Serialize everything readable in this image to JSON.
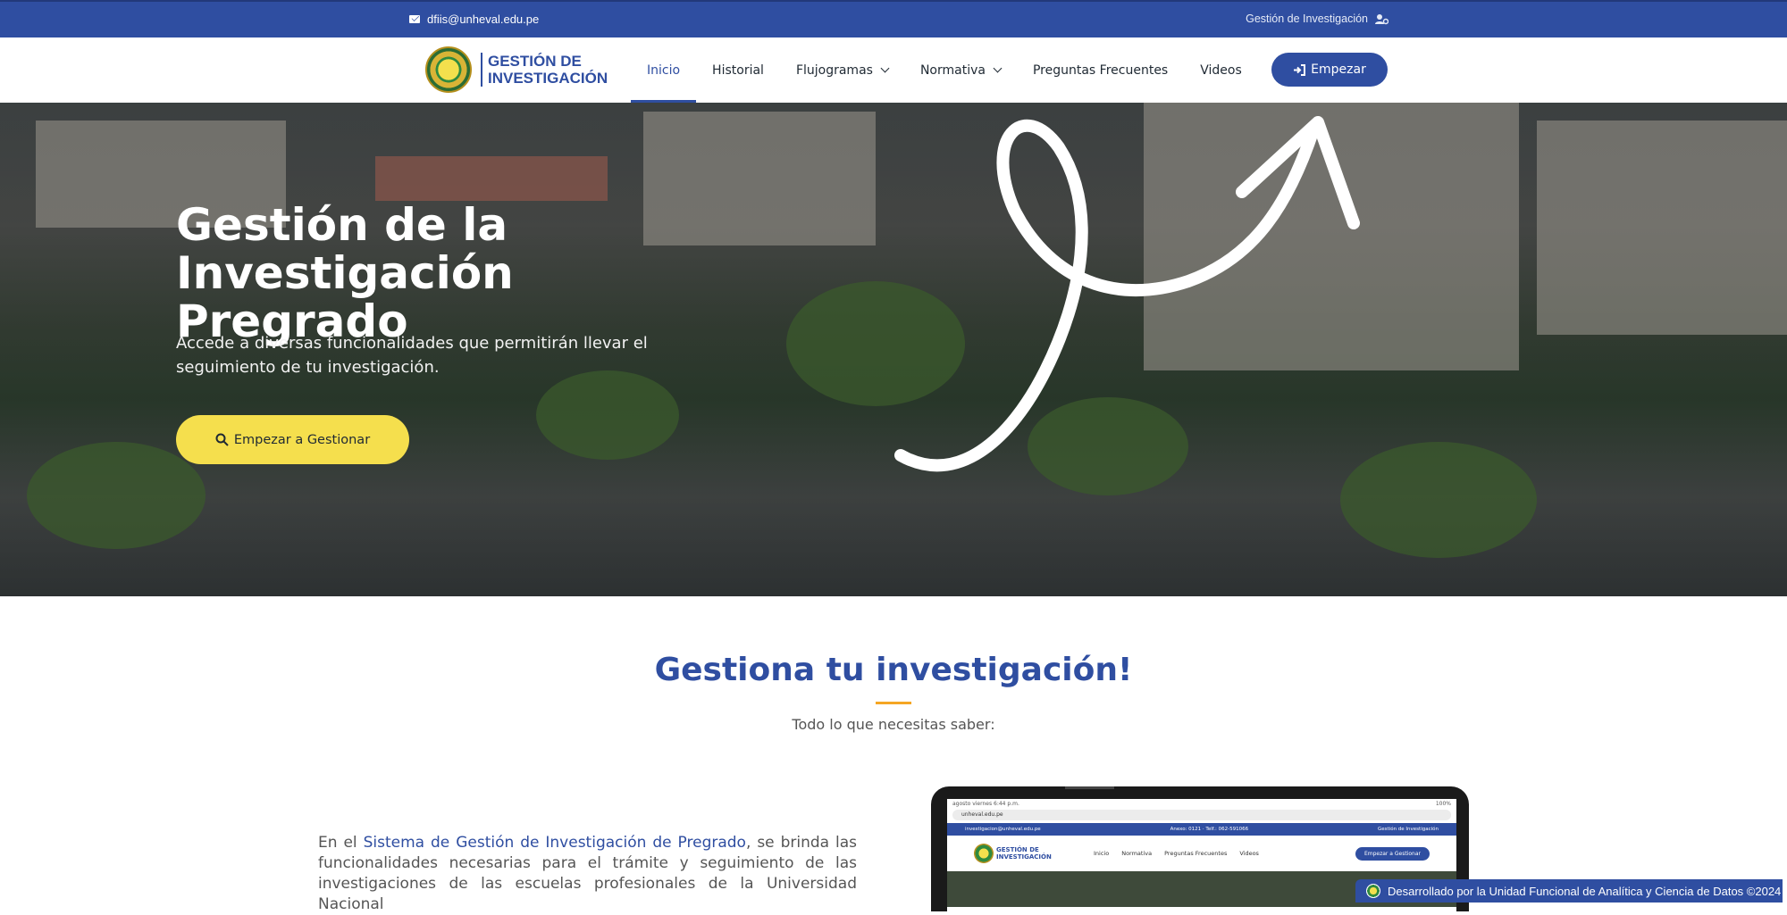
{
  "topbar": {
    "email": "dfiis@unheval.edu.pe",
    "right_label": "Gestión de Investigación",
    "email_icon": "envelope-icon",
    "user_icon": "user-gear-icon"
  },
  "header": {
    "logo_text_line1": "GESTIÓN DE",
    "logo_text_line2": "INVESTIGACIÓN",
    "nav": [
      {
        "label": "Inicio",
        "active": true
      },
      {
        "label": "Historial"
      },
      {
        "label": "Flujogramas",
        "dropdown": true
      },
      {
        "label": "Normativa",
        "dropdown": true
      },
      {
        "label": "Preguntas Frecuentes"
      },
      {
        "label": "Videos"
      }
    ],
    "cta_label": "Empezar",
    "cta_icon": "sign-in-icon"
  },
  "hero": {
    "title_line1": "Gestión de la Investigación",
    "title_line2": "Pregrado",
    "subtitle": "Accede a diversas funcionalidades que permitirán llevar el seguimiento de tu investigación.",
    "button_label": "Empezar a Gestionar",
    "button_icon": "search-icon"
  },
  "section": {
    "title": "Gestiona tu investigación!",
    "subtitle": "Todo lo que necesitas saber:",
    "paragraph_prefix": "En el ",
    "paragraph_highlight": "Sistema de Gestión de Investigación de Pregrado",
    "paragraph_rest": ", se brinda las funcionalidades necesarias para el trámite y seguimiento de las investigaciones de las escuelas profesionales de la Universidad Nacional"
  },
  "laptop_preview": {
    "status_left": "agosto viernes 6:44 p.m.",
    "status_right": "100%",
    "url": "unheval.edu.pe",
    "top_left": "investigacion@unheval.edu.pe",
    "top_mid": "Anexo: 0121 · Telf.: 062-591066",
    "top_right": "Gestión de Investigación",
    "logo_line1": "GESTIÓN DE",
    "logo_line2": "INVESTIGACIÓN",
    "nav": [
      "Inicio",
      "Normativa",
      "Preguntas Frecuentes",
      "Videos"
    ],
    "button": "Empezar a Gestionar"
  },
  "footer_badge": {
    "text": "Desarrollado por la Unidad Funcional de Analítica y Ciencia de Datos ©2024"
  },
  "colors": {
    "primary": "#2f4ea1",
    "accent_yellow": "#f5df4d",
    "accent_orange": "#f5a623"
  }
}
